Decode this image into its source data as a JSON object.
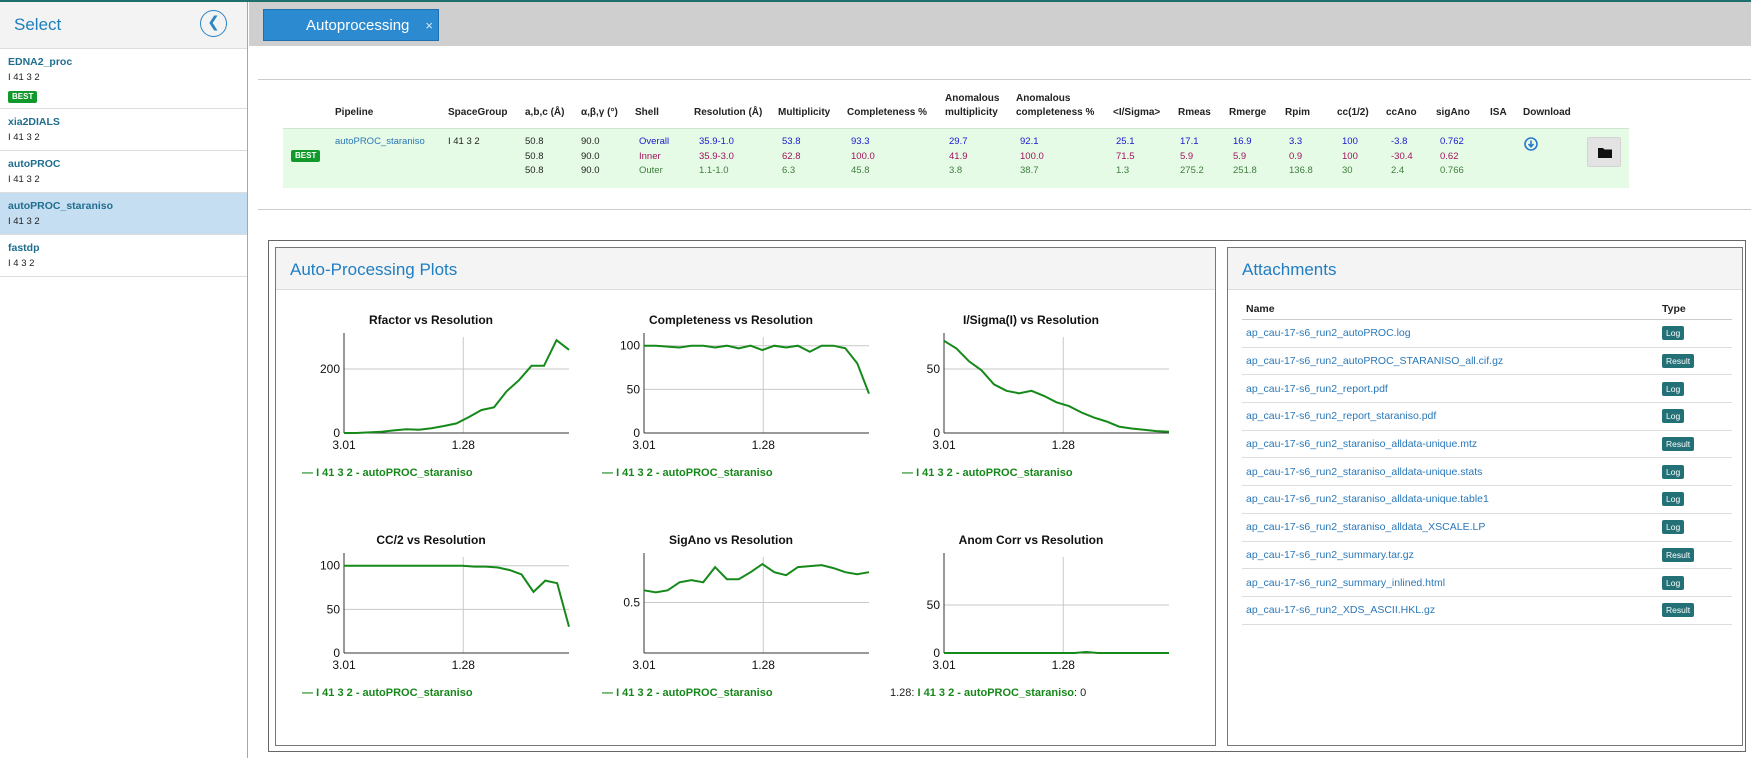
{
  "sidebar": {
    "title": "Select",
    "items": [
      {
        "name": "EDNA2_proc",
        "spacegroup": "I 41 3 2",
        "badge": "BEST"
      },
      {
        "name": "xia2DIALS",
        "spacegroup": "I 41 3 2"
      },
      {
        "name": "autoPROC",
        "spacegroup": "I 41 3 2"
      },
      {
        "name": "autoPROC_staraniso",
        "spacegroup": "I 41 3 2"
      },
      {
        "name": "fastdp",
        "spacegroup": "I 4 3 2"
      }
    ]
  },
  "tab": {
    "label": "Autoprocessing",
    "close": "×"
  },
  "summary": {
    "headers": {
      "pipeline": "Pipeline",
      "spacegroup": "SpaceGroup",
      "abc": "a,b,c (Å)",
      "angles": "α,β,γ (°)",
      "shell": "Shell",
      "resolution": "Resolution (Å)",
      "multiplicity": "Multiplicity",
      "completeness": "Completeness %",
      "anom_mult_1": "Anomalous",
      "anom_mult_2": "multiplicity",
      "anom_comp_1": "Anomalous",
      "anom_comp_2": "completeness %",
      "isigma": "<I/Sigma>",
      "rmeas": "Rmeas",
      "rmerge": "Rmerge",
      "rpim": "Rpim",
      "cchalf": "cc(1/2)",
      "ccano": "ccAno",
      "sigano": "sigAno",
      "isa": "ISA",
      "download": "Download"
    },
    "badge": "BEST",
    "pipeline": "autoPROC_staraniso",
    "spacegroup": "I 41 3 2",
    "abc": [
      "50.8",
      "50.8",
      "50.8"
    ],
    "angles": [
      "90.0",
      "90.0",
      "90.0"
    ],
    "shells": [
      "Overall",
      "Inner",
      "Outer"
    ],
    "resolution": [
      "35.9-1.0",
      "35.9-3.0",
      "1.1-1.0"
    ],
    "multiplicity": [
      "53.8",
      "62.8",
      "6.3"
    ],
    "completeness": [
      "93.3",
      "100.0",
      "45.8"
    ],
    "anom_mult": [
      "29.7",
      "41.9",
      "3.8"
    ],
    "anom_comp": [
      "92.1",
      "100.0",
      "38.7"
    ],
    "isigma": [
      "25.1",
      "71.5",
      "1.3"
    ],
    "rmeas": [
      "17.1",
      "5.9",
      "275.2"
    ],
    "rmerge": [
      "16.9",
      "5.9",
      "251.8"
    ],
    "rpim": [
      "3.3",
      "0.9",
      "136.8"
    ],
    "cchalf": [
      "100",
      "100",
      "30"
    ],
    "ccano": [
      "-3.8",
      "-30.4",
      "2.4"
    ],
    "sigano": [
      "0.762",
      "0.62",
      "0.766"
    ]
  },
  "plots_panel": {
    "title": "Auto-Processing Plots"
  },
  "chart_data": [
    {
      "type": "line",
      "title": "Rfactor vs Resolution",
      "xticks": [
        "3.01",
        "1.28"
      ],
      "yticks": [
        0,
        200
      ],
      "ylim": [
        0,
        300
      ],
      "series": [
        {
          "name": "I 41 3 2 - autoPROC_staraniso",
          "values": [
            0,
            0,
            2,
            4,
            8,
            12,
            10,
            15,
            22,
            30,
            50,
            72,
            80,
            130,
            165,
            210,
            210,
            290,
            260
          ]
        }
      ]
    },
    {
      "type": "line",
      "title": "Completeness vs Resolution",
      "xticks": [
        "3.01",
        "1.28"
      ],
      "yticks": [
        0,
        50,
        100
      ],
      "ylim": [
        0,
        110
      ],
      "series": [
        {
          "name": "I 41 3 2 - autoPROC_staraniso",
          "values": [
            100,
            100,
            99,
            98,
            100,
            100,
            98,
            100,
            97,
            100,
            95,
            100,
            98,
            100,
            93,
            100,
            100,
            97,
            80,
            45
          ]
        }
      ]
    },
    {
      "type": "line",
      "title": "I/Sigma(I) vs Resolution",
      "xticks": [
        "3.01",
        "1.28"
      ],
      "yticks": [
        0,
        50
      ],
      "ylim": [
        0,
        75
      ],
      "series": [
        {
          "name": "I 41 3 2 - autoPROC_staraniso",
          "values": [
            72,
            66,
            56,
            49,
            38,
            33,
            31,
            33,
            29,
            24,
            21,
            16,
            12,
            9,
            5,
            3.5,
            2.5,
            1.5,
            1
          ]
        }
      ]
    },
    {
      "type": "line",
      "title": "CC/2 vs Resolution",
      "xticks": [
        "3.01",
        "1.28"
      ],
      "yticks": [
        0,
        50,
        100
      ],
      "ylim": [
        0,
        110
      ],
      "series": [
        {
          "name": "I 41 3 2 - autoPROC_staraniso",
          "values": [
            100,
            100,
            100,
            100,
            100,
            100,
            100,
            100,
            100,
            100,
            100,
            99,
            99,
            98,
            95,
            90,
            70,
            83,
            80,
            30
          ]
        }
      ]
    },
    {
      "type": "line",
      "title": "SigAno vs Resolution",
      "xticks": [
        "3.01",
        "1.28"
      ],
      "yticks": [
        0.5
      ],
      "ylim": [
        0,
        0.95
      ],
      "series": [
        {
          "name": "I 41 3 2 - autoPROC_staraniso",
          "values": [
            0.62,
            0.6,
            0.62,
            0.7,
            0.72,
            0.7,
            0.85,
            0.73,
            0.73,
            0.8,
            0.88,
            0.8,
            0.77,
            0.85,
            0.86,
            0.87,
            0.84,
            0.8,
            0.78,
            0.8
          ]
        }
      ]
    },
    {
      "type": "line",
      "title": "Anom Corr vs Resolution",
      "xticks": [
        "3.01",
        "1.28"
      ],
      "yticks": [
        0,
        50
      ],
      "ylim": [
        0,
        100
      ],
      "legend_prefix": "1.28:",
      "legend_suffix": ": 0",
      "series": [
        {
          "name": "I 41 3 2 - autoPROC_staraniso",
          "values": [
            0,
            0,
            0,
            0,
            0,
            0,
            0,
            0,
            0,
            0,
            0,
            0,
            1,
            0,
            0,
            0,
            0,
            0,
            0,
            0
          ]
        }
      ]
    }
  ],
  "attachments": {
    "title": "Attachments",
    "col_name": "Name",
    "col_type": "Type",
    "rows": [
      {
        "name": "ap_cau-17-s6_run2_autoPROC.log",
        "type": "Log"
      },
      {
        "name": "ap_cau-17-s6_run2_autoPROC_STARANISO_all.cif.gz",
        "type": "Result"
      },
      {
        "name": "ap_cau-17-s6_run2_report.pdf",
        "type": "Log"
      },
      {
        "name": "ap_cau-17-s6_run2_report_staraniso.pdf",
        "type": "Log"
      },
      {
        "name": "ap_cau-17-s6_run2_staraniso_alldata-unique.mtz",
        "type": "Result"
      },
      {
        "name": "ap_cau-17-s6_run2_staraniso_alldata-unique.stats",
        "type": "Log"
      },
      {
        "name": "ap_cau-17-s6_run2_staraniso_alldata-unique.table1",
        "type": "Log"
      },
      {
        "name": "ap_cau-17-s6_run2_staraniso_alldata_XSCALE.LP",
        "type": "Log"
      },
      {
        "name": "ap_cau-17-s6_run2_summary.tar.gz",
        "type": "Result"
      },
      {
        "name": "ap_cau-17-s6_run2_summary_inlined.html",
        "type": "Log"
      },
      {
        "name": "ap_cau-17-s6_run2_XDS_ASCII.HKL.gz",
        "type": "Result"
      }
    ]
  },
  "colors": {
    "series": "#15891a",
    "accent": "#2b8ad0",
    "row_bg": "#e6fbe5"
  }
}
